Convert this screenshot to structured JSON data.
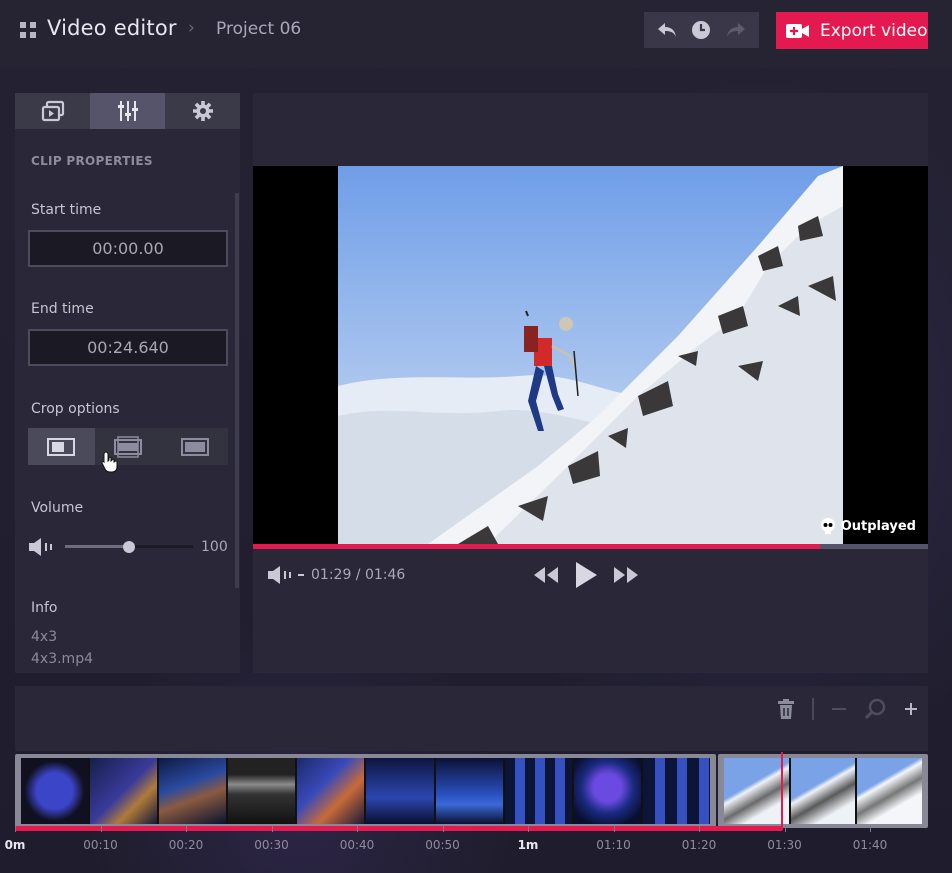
{
  "header": {
    "app_title": "Video editor",
    "breadcrumb_sep": "›",
    "project_name": "Project 06",
    "export_label": "Export video",
    "accent": "#e4194f"
  },
  "left_panel": {
    "tabs": [
      {
        "icon": "video-library-icon",
        "active": false
      },
      {
        "icon": "sliders-icon",
        "active": true
      },
      {
        "icon": "gear-icon",
        "active": false
      }
    ],
    "section_title": "CLIP PROPERTIES",
    "start_time_label": "Start time",
    "start_time_value": "00:00.00",
    "end_time_label": "End time",
    "end_time_value": "00:24.640",
    "crop_label": "Crop options",
    "crop_options": [
      "crop-fit-icon",
      "crop-fill-icon",
      "crop-stretch-icon"
    ],
    "crop_selected": 0,
    "volume_label": "Volume",
    "volume_value": "100",
    "volume_level": 0.5,
    "info_label": "Info",
    "info_aspect": "4x3",
    "info_file": "4x3.mp4"
  },
  "preview": {
    "watermark": "Outplayed",
    "time_display": "01:29 / 01:46",
    "progress": 0.84
  },
  "timeline": {
    "ticks": [
      "0m",
      "00:10",
      "00:20",
      "00:30",
      "00:40",
      "00:50",
      "1m",
      "01:10",
      "01:20",
      "01:30",
      "01:40"
    ],
    "playhead": 0.84
  }
}
